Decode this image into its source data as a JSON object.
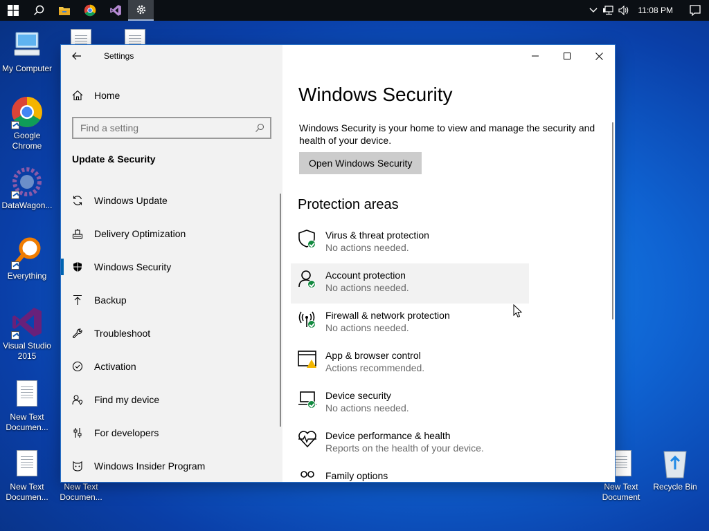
{
  "taskbar": {
    "clock": "11:08 PM",
    "apps": [
      "start-icon",
      "search-icon",
      "file-explorer-icon",
      "chrome-icon",
      "visual-studio-icon",
      "settings-icon"
    ]
  },
  "desktop": {
    "left_icons": [
      {
        "label": "My Computer"
      },
      {
        "label": "Google Chrome"
      },
      {
        "label": "DataWagon..."
      },
      {
        "label": "Everything"
      },
      {
        "label": "Visual Studio 2015"
      },
      {
        "label": "New Text Documen..."
      },
      {
        "label": "New Text Documen..."
      }
    ],
    "bottom_icons": [
      {
        "label": "New Text Documen..."
      },
      {
        "label": "New Text Document"
      },
      {
        "label": "Recycle Bin"
      }
    ]
  },
  "window": {
    "title": "Settings",
    "sidebar": {
      "home": "Home",
      "search_placeholder": "Find a setting",
      "section": "Update & Security",
      "items": [
        {
          "label": "Windows Update",
          "icon": "refresh-icon"
        },
        {
          "label": "Delivery Optimization",
          "icon": "delivery-icon"
        },
        {
          "label": "Windows Security",
          "icon": "shield-icon",
          "selected": true
        },
        {
          "label": "Backup",
          "icon": "backup-arrow-icon"
        },
        {
          "label": "Troubleshoot",
          "icon": "wrench-icon"
        },
        {
          "label": "Activation",
          "icon": "check-circle-icon"
        },
        {
          "label": "Find my device",
          "icon": "person-pin-icon"
        },
        {
          "label": "For developers",
          "icon": "developer-sliders-icon"
        },
        {
          "label": "Windows Insider Program",
          "icon": "insider-cat-icon"
        }
      ]
    },
    "main": {
      "title": "Windows Security",
      "description": "Windows Security is your home to view and manage the security and health of your device.",
      "open_button": "Open Windows Security",
      "areas_title": "Protection areas",
      "areas": [
        {
          "name": "Virus & threat protection",
          "status": "No actions needed.",
          "icon": "virus-shield-icon",
          "state": "ok"
        },
        {
          "name": "Account protection",
          "status": "No actions needed.",
          "icon": "account-person-icon",
          "state": "ok"
        },
        {
          "name": "Firewall & network protection",
          "status": "No actions needed.",
          "icon": "firewall-antenna-icon",
          "state": "ok"
        },
        {
          "name": "App & browser control",
          "status": "Actions recommended.",
          "icon": "app-browser-icon",
          "state": "warning"
        },
        {
          "name": "Device security",
          "status": "No actions needed.",
          "icon": "device-laptop-icon",
          "state": "ok"
        },
        {
          "name": "Device performance & health",
          "status": "Reports on the health of your device.",
          "icon": "heart-pulse-icon",
          "state": "none"
        },
        {
          "name": "Family options",
          "status": "",
          "icon": "family-icon",
          "state": "none"
        }
      ]
    }
  },
  "colors": {
    "accent": "#0063b1",
    "ok": "#10893e",
    "warning": "#f2b600"
  }
}
